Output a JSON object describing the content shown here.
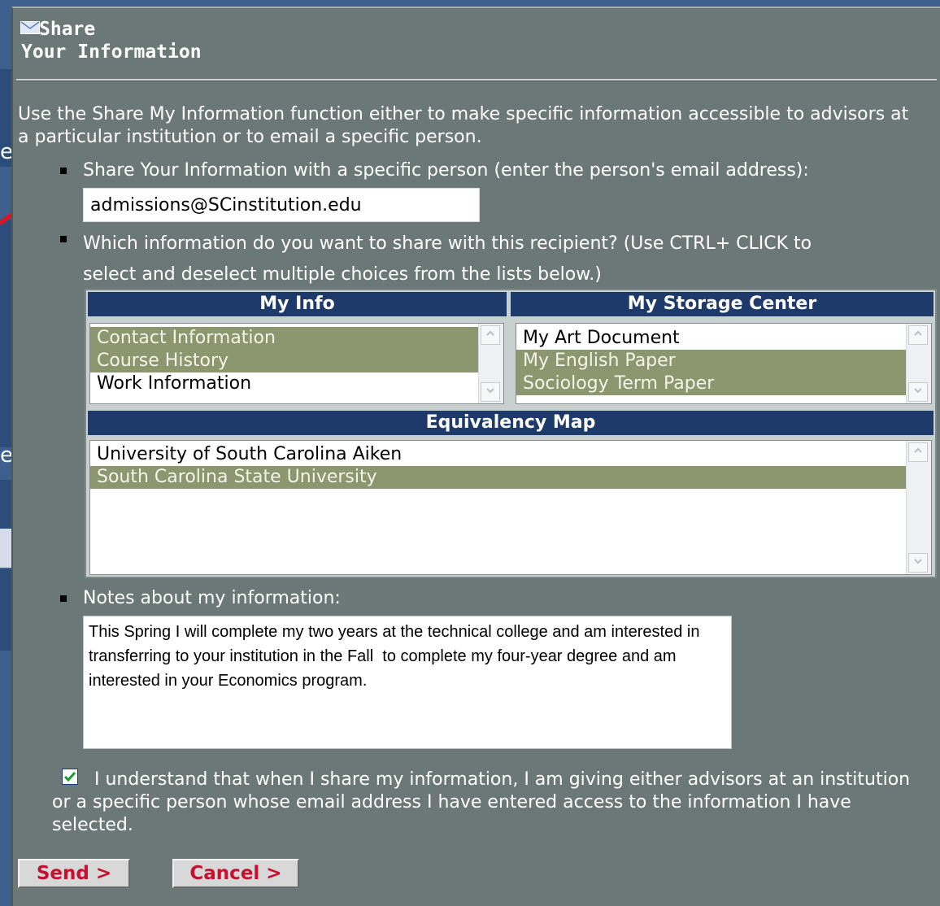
{
  "dialog": {
    "title_line1": "Share",
    "title_line2": "Your Information",
    "intro": "Use the Share My Information function either to make specific information accessible to advisors at a particular institution or to email a specific person."
  },
  "share_person": {
    "label": "Share Your Information with a specific person (enter the person's email address):",
    "email_value": "admissions@SCinstitution.edu"
  },
  "which_info": {
    "label": "Which information do you want to share with this recipient? (Use CTRL+ CLICK to select and deselect multiple choices from the lists below.)",
    "line1": "Which information do you want to share with this recipient? (Use CTRL+ CLICK to",
    "line2": "select and deselect multiple choices from the lists below.)"
  },
  "my_info": {
    "header": "My Info",
    "options": [
      {
        "label": "Contact Information",
        "selected": true
      },
      {
        "label": "Course History",
        "selected": true
      },
      {
        "label": "Work Information",
        "selected": false
      }
    ]
  },
  "my_storage": {
    "header": "My Storage Center",
    "options": [
      {
        "label": "My Art Document",
        "selected": false
      },
      {
        "label": "My English Paper",
        "selected": true
      },
      {
        "label": "Sociology Term Paper",
        "selected": true
      }
    ]
  },
  "equivalency_map": {
    "header": "Equivalency Map",
    "options": [
      {
        "label": "University of South Carolina Aiken",
        "selected": false
      },
      {
        "label": "South Carolina State University",
        "selected": true
      }
    ]
  },
  "notes": {
    "label": "Notes about my information:",
    "value": "This Spring I will complete my two years at the technical college and am interested in transferring to your institution in the Fall  to complete my four-year degree and am interested in your Economics program."
  },
  "agreement": {
    "checked": true,
    "text": "I understand that when I share my information, I am giving either advisors at an institution or a specific person whose email address I have entered access to the information I have selected."
  },
  "buttons": {
    "send": "Send >",
    "cancel": "Cancel >"
  },
  "background": {
    "letter1": "e",
    "letter2": "e"
  },
  "colors": {
    "panel_bg": "#6c7878",
    "header_bg": "#1d3a6b",
    "selected_bg": "#8c9770",
    "button_text": "#c8102e",
    "annotation_arrow": "#e0141e"
  },
  "icons": {
    "title": "envelope-icon",
    "annotation": "red-arrow-icon",
    "checkbox": "checkmark-icon"
  }
}
